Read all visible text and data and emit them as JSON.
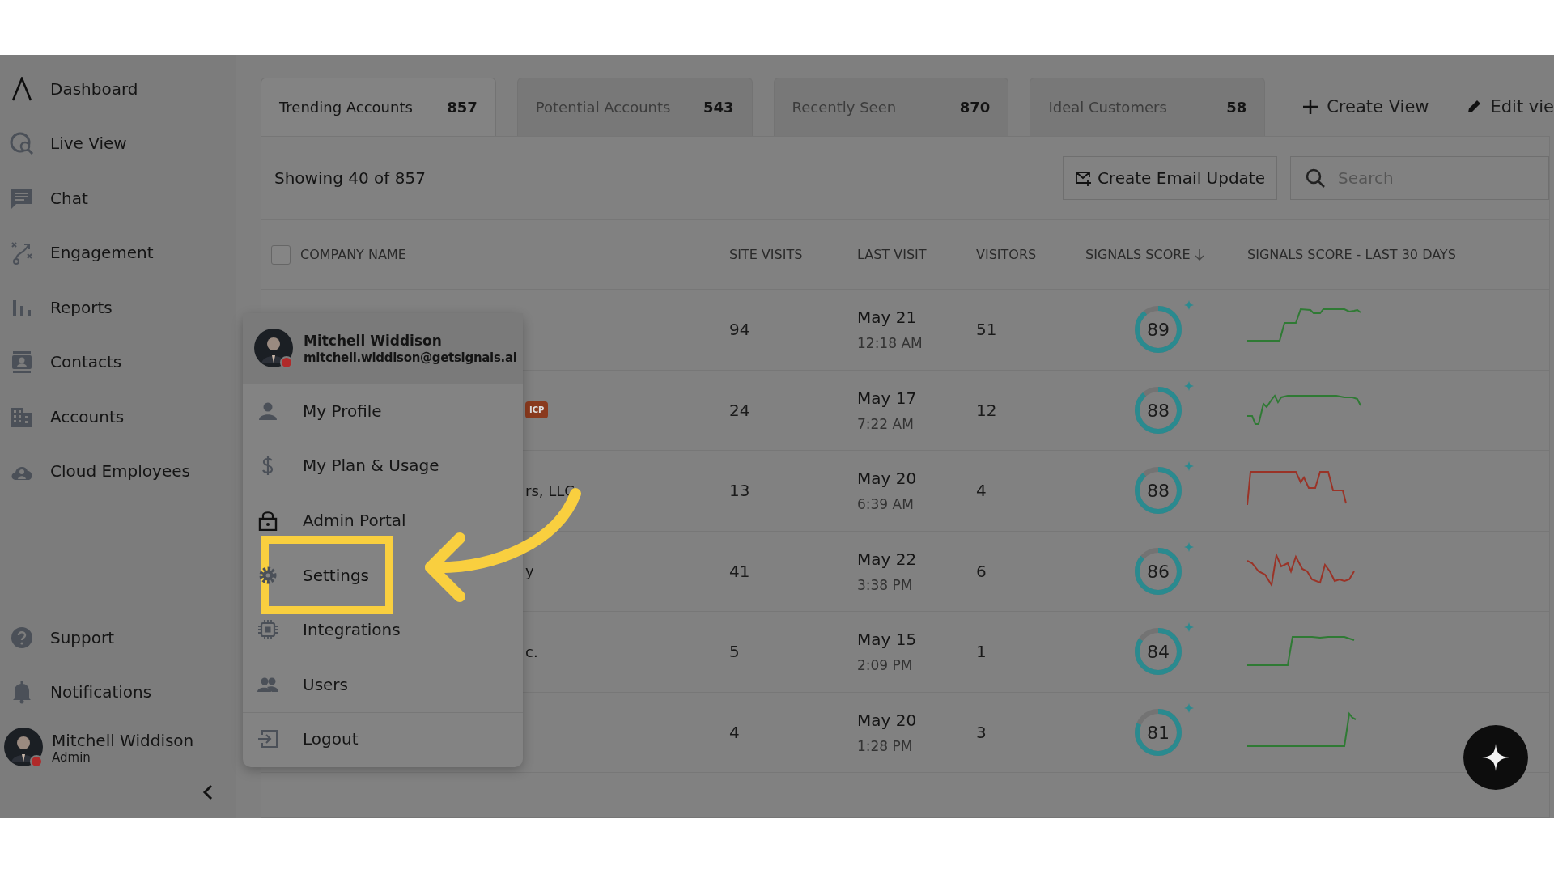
{
  "sidebar": {
    "items": [
      {
        "label": "Dashboard"
      },
      {
        "label": "Live View"
      },
      {
        "label": "Chat"
      },
      {
        "label": "Engagement"
      },
      {
        "label": "Reports"
      },
      {
        "label": "Contacts"
      },
      {
        "label": "Accounts"
      },
      {
        "label": "Cloud Employees"
      }
    ],
    "bottom_items": [
      {
        "label": "Support"
      },
      {
        "label": "Notifications"
      }
    ],
    "user": {
      "name": "Mitchell Widdison",
      "role": "Admin"
    }
  },
  "tabs": [
    {
      "label": "Trending Accounts",
      "count": "857",
      "selected": true
    },
    {
      "label": "Potential Accounts",
      "count": "543",
      "selected": false
    },
    {
      "label": "Recently Seen",
      "count": "870",
      "selected": false
    },
    {
      "label": "Ideal Customers",
      "count": "58",
      "selected": false
    }
  ],
  "view_actions": [
    {
      "kind": "create",
      "label": "Create View"
    },
    {
      "kind": "edit",
      "label": "Edit vie"
    }
  ],
  "toolbar": {
    "showing": "Showing 40 of  857",
    "email_button": "Create Email Update",
    "search": {
      "placeholder": "Search"
    }
  },
  "table": {
    "select_all": {
      "checked": false
    },
    "columns": [
      {
        "label": "COMPANY NAME",
        "sorted": false
      },
      {
        "label": "SITE VISITS",
        "sorted": false
      },
      {
        "label": "LAST VISIT",
        "sorted": false
      },
      {
        "label": "VISITORS",
        "sorted": false
      },
      {
        "label": "SIGNALS SCORE",
        "sorted": true
      },
      {
        "label": "SIGNALS SCORE - LAST 30 DAYS",
        "sorted": false
      }
    ],
    "rows": [
      {
        "site_visits": "94",
        "date": "May 21",
        "time": "12:18 AM",
        "visitors": "51",
        "score": "89",
        "level": 0.89,
        "color": "#2f7a34"
      },
      {
        "badge": "ICP",
        "site_visits": "24",
        "date": "May 17",
        "time": "7:22 AM",
        "visitors": "12",
        "score": "88",
        "level": 0.88,
        "color": "#2f7a34"
      },
      {
        "company": "rs, LLC",
        "site_visits": "13",
        "date": "May 20",
        "time": "6:39 AM",
        "visitors": "4",
        "score": "88",
        "level": 0.88,
        "color": "#9a3327"
      },
      {
        "company": "y",
        "site_visits": "41",
        "date": "May 22",
        "time": "3:38 PM",
        "visitors": "6",
        "score": "86",
        "level": 0.86,
        "color": "#9a3327"
      },
      {
        "company": "c.",
        "site_visits": "5",
        "date": "May 15",
        "time": "2:09 PM",
        "visitors": "1",
        "score": "84",
        "level": 0.84,
        "color": "#2f7a34"
      },
      {
        "site_visits": "4",
        "date": "May 20",
        "time": "1:28 PM",
        "visitors": "3",
        "score": "81",
        "level": 0.81,
        "color": "#2f7a34"
      }
    ]
  },
  "user_menu": {
    "name": "Mitchell Widdison",
    "email": "mitchell.widdison@getsignals.ai",
    "items": [
      {
        "label": "My Profile",
        "highlighted": false
      },
      {
        "label": "My Plan & Usage",
        "highlighted": false
      },
      {
        "label": "Admin Portal",
        "highlighted": false
      },
      {
        "label": "Settings",
        "highlighted": true
      },
      {
        "label": "Integrations",
        "highlighted": false
      },
      {
        "label": "Users",
        "highlighted": false
      },
      {
        "label": "Logout",
        "highlighted": false
      }
    ]
  }
}
